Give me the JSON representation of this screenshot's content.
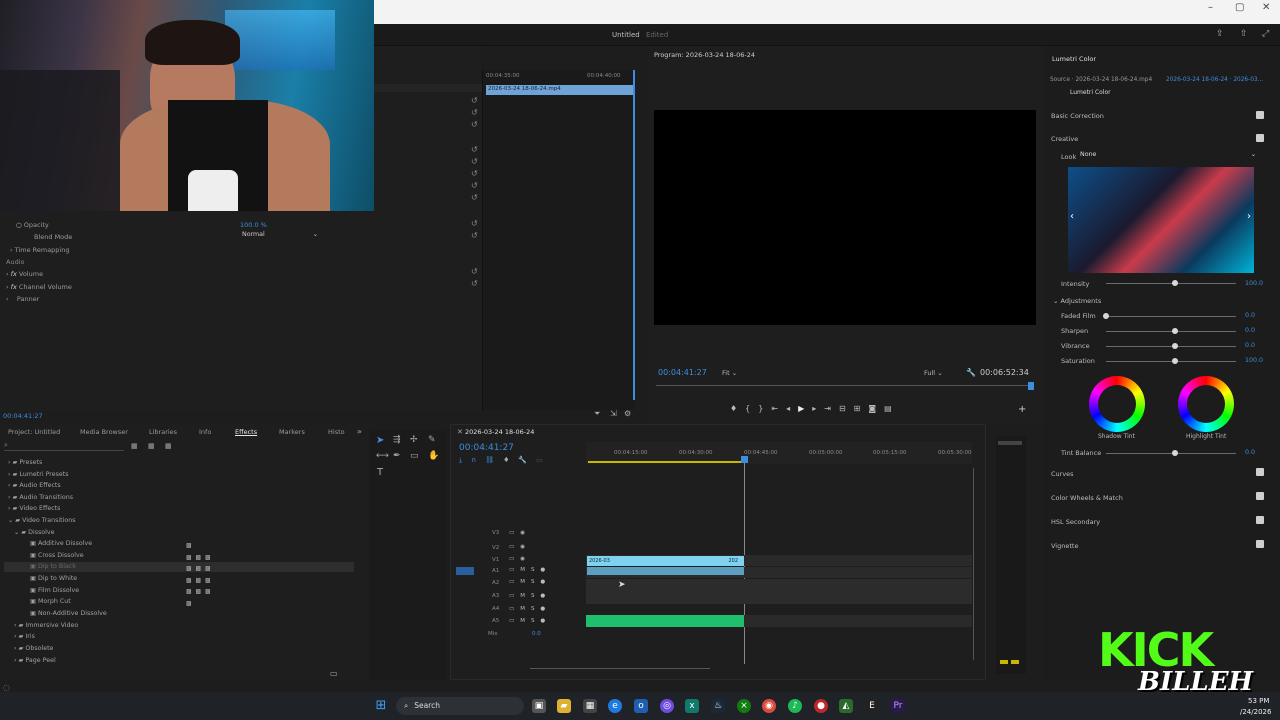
{
  "window": {
    "title": "Untitled",
    "status": "Edited",
    "controls": [
      "–",
      "▢",
      "✕"
    ]
  },
  "source_timecode_left": "00:04:35:00",
  "source_timecode_right": "00:04:40:00",
  "source_clip_name": "2026-03-24 18-06-24.mp4",
  "effect_controls": {
    "opacity_label": "Opacity",
    "opacity_value": "100.0 %",
    "blend_mode_label": "Blend Mode",
    "blend_mode_value": "Normal",
    "time_remapping": "Time Remapping",
    "audio_header": "Audio",
    "volume": "Volume",
    "channel_volume": "Channel Volume",
    "panner": "Panner",
    "bottom_timecode": "00:04:41:27"
  },
  "program": {
    "title": "Program: 2026-03-24 18-06-24",
    "timecode": "00:04:41:27",
    "fit": "Fit",
    "full": "Full",
    "duration": "00:06:52:34"
  },
  "lumetri": {
    "title": "Lumetri Color",
    "source": "Source · 2026-03-24 18-06-24.mp4",
    "source_seq": "2026-03-24 18-06-24 · 2026-03...",
    "effect_name": "Lumetri Color",
    "basic_correction": "Basic Correction",
    "creative": "Creative",
    "look_label": "Look",
    "look_value": "None",
    "intensity_label": "Intensity",
    "intensity_value": "100.0",
    "adjustments": "Adjustments",
    "faded_film": "Faded Film",
    "faded_film_value": "0.0",
    "sharpen": "Sharpen",
    "sharpen_value": "0.0",
    "vibrance": "Vibrance",
    "vibrance_value": "0.0",
    "saturation": "Saturation",
    "saturation_value": "100.0",
    "shadow_tint": "Shadow Tint",
    "highlight_tint": "Highlight Tint",
    "tint_balance": "Tint Balance",
    "tint_balance_value": "0.0",
    "curves": "Curves",
    "color_wheels": "Color Wheels & Match",
    "hsl": "HSL Secondary",
    "vignette": "Vignette"
  },
  "project_tabs": [
    "Project: Untitled",
    "Media Browser",
    "Libraries",
    "Info",
    "Effects",
    "Markers",
    "Histo"
  ],
  "effects_tree": [
    "Presets",
    "Lumetri Presets",
    "Audio Effects",
    "Audio Transitions",
    "Video Effects",
    "Video Transitions",
    "Dissolve",
    "Additive Dissolve",
    "Cross Dissolve",
    "Dip to Black",
    "Dip to White",
    "Film Dissolve",
    "Morph Cut",
    "Non-Additive Dissolve",
    "Immersive Video",
    "Iris",
    "Obsolete",
    "Page Peel"
  ],
  "timeline": {
    "sequence_name": "2026-03-24 18-06-24",
    "timecode": "00:04:41:27",
    "ruler": [
      "00:04:15:00",
      "00:04:30:00",
      "00:04:45:00",
      "00:05:00:00",
      "00:05:15:00",
      "00:05:30:00"
    ],
    "tracks": [
      "V3",
      "V2",
      "V1",
      "A1",
      "A2",
      "A3",
      "A4",
      "A5"
    ],
    "mix_label": "Mix",
    "mix_value": "0.0",
    "clip_label": "2026-03",
    "clip_label_end": "202"
  },
  "overlay": {
    "brand_top": "KICK",
    "brand_bottom": "BILLEH"
  },
  "taskbar": {
    "search": "Search",
    "clock_time": "53 PM",
    "clock_date": "/24/2026"
  },
  "colors": {
    "accent_blue": "#3d8ee0",
    "clip_cyan": "#7fd3ee",
    "audio_green": "#1fbf6e",
    "kick_green": "#53fc18"
  }
}
